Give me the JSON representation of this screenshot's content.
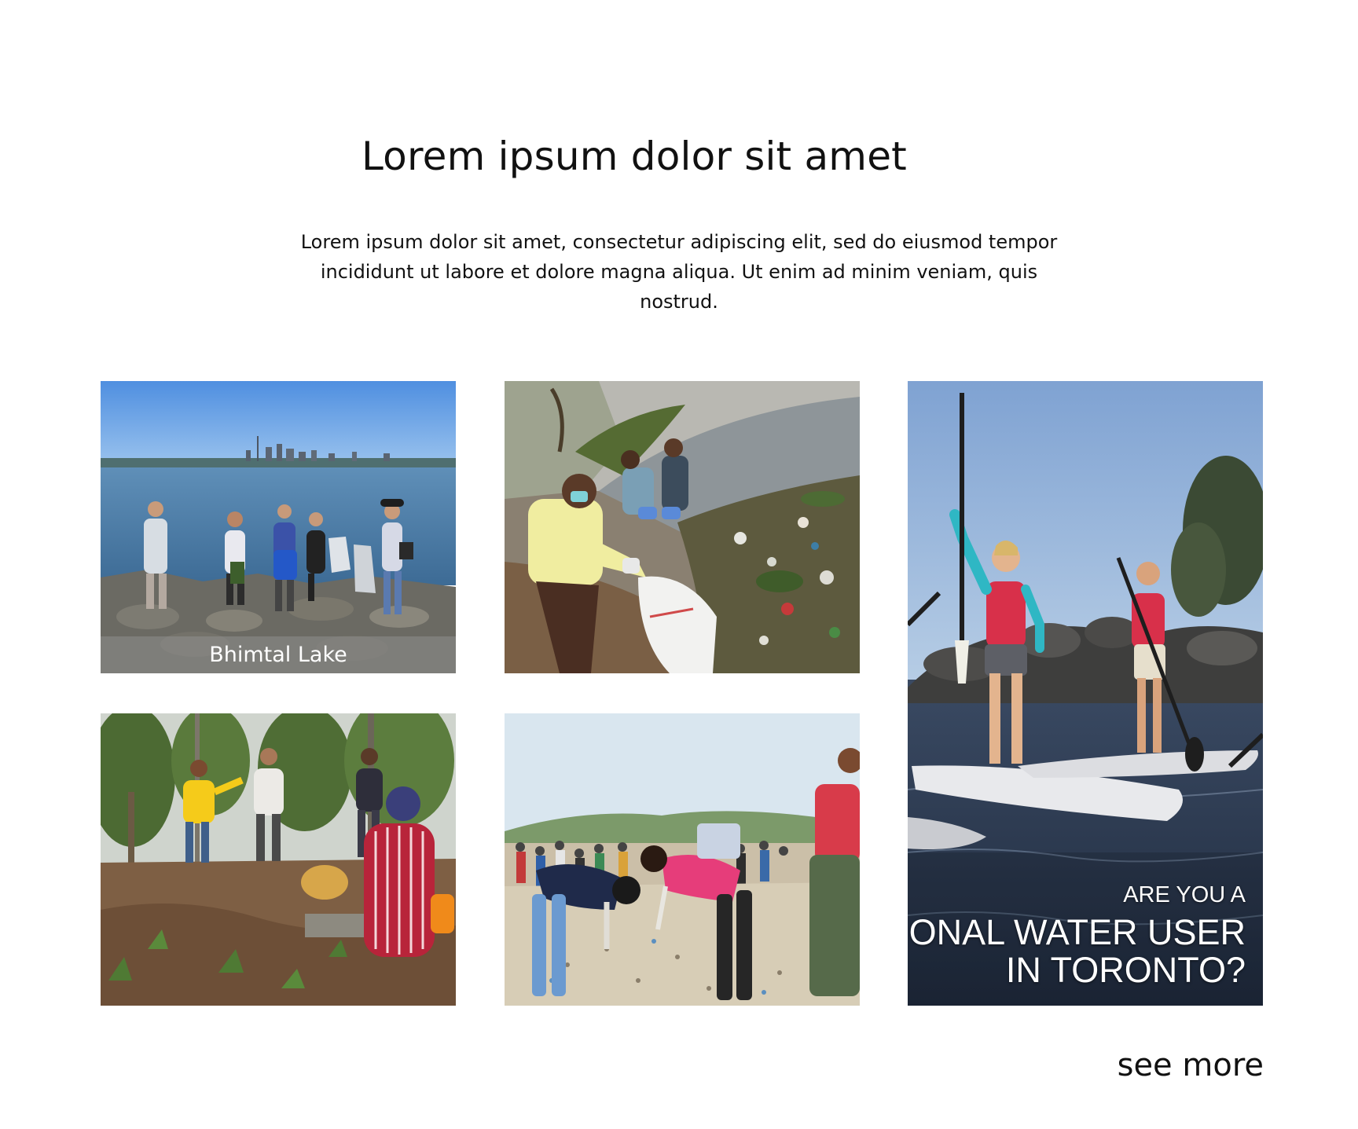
{
  "header": {
    "title": "Lorem ipsum dolor sit amet",
    "intro": "Lorem ipsum dolor sit amet, consectetur adipiscing elit, sed do eiusmod tempor incididunt ut labore et dolore magna aliqua. Ut enim ad minim veniam, quis nostrud."
  },
  "gallery": {
    "tiles": [
      {
        "caption": "Bhimtal Lake"
      },
      {
        "caption": ""
      },
      {
        "poster_lines": [
          "ARE YOU A",
          "ATIONAL WATER USER",
          "IN TORONTO?"
        ]
      },
      {
        "caption": ""
      },
      {
        "caption": ""
      }
    ]
  },
  "footer": {
    "see_more_label": "see more"
  }
}
